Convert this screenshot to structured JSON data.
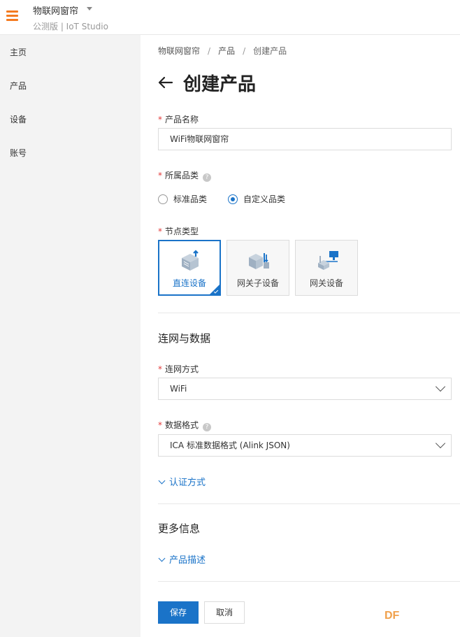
{
  "header": {
    "app_name": "物联网窗帘",
    "app_sub": "公测版 | IoT Studio"
  },
  "sidebar": {
    "items": [
      {
        "label": "主页"
      },
      {
        "label": "产品"
      },
      {
        "label": "设备"
      },
      {
        "label": "账号"
      }
    ]
  },
  "breadcrumb": {
    "items": [
      "物联网窗帘",
      "产品",
      "创建产品"
    ],
    "separator": "/"
  },
  "page": {
    "title": "创建产品"
  },
  "form": {
    "product_name": {
      "label": "产品名称",
      "value": "WiFi物联网窗帘"
    },
    "category": {
      "label": "所属品类",
      "options": [
        {
          "label": "标准品类",
          "checked": false
        },
        {
          "label": "自定义品类",
          "checked": true
        }
      ]
    },
    "node_type": {
      "label": "节点类型",
      "options": [
        {
          "label": "直连设备",
          "selected": true
        },
        {
          "label": "网关子设备",
          "selected": false
        },
        {
          "label": "网关设备",
          "selected": false
        }
      ]
    },
    "network_section": {
      "title": "连网与数据"
    },
    "network_method": {
      "label": "连网方式",
      "value": "WiFi"
    },
    "data_format": {
      "label": "数据格式",
      "value": "ICA 标准数据格式 (Alink JSON)"
    },
    "auth_link": "认证方式",
    "more_section": {
      "title": "更多信息"
    },
    "desc_link": "产品描述"
  },
  "buttons": {
    "save": "保存",
    "cancel": "取消"
  },
  "watermark": "DF",
  "colors": {
    "accent": "#1a73c8",
    "menu_icon": "#f47b20",
    "required": "#e23b3b"
  }
}
